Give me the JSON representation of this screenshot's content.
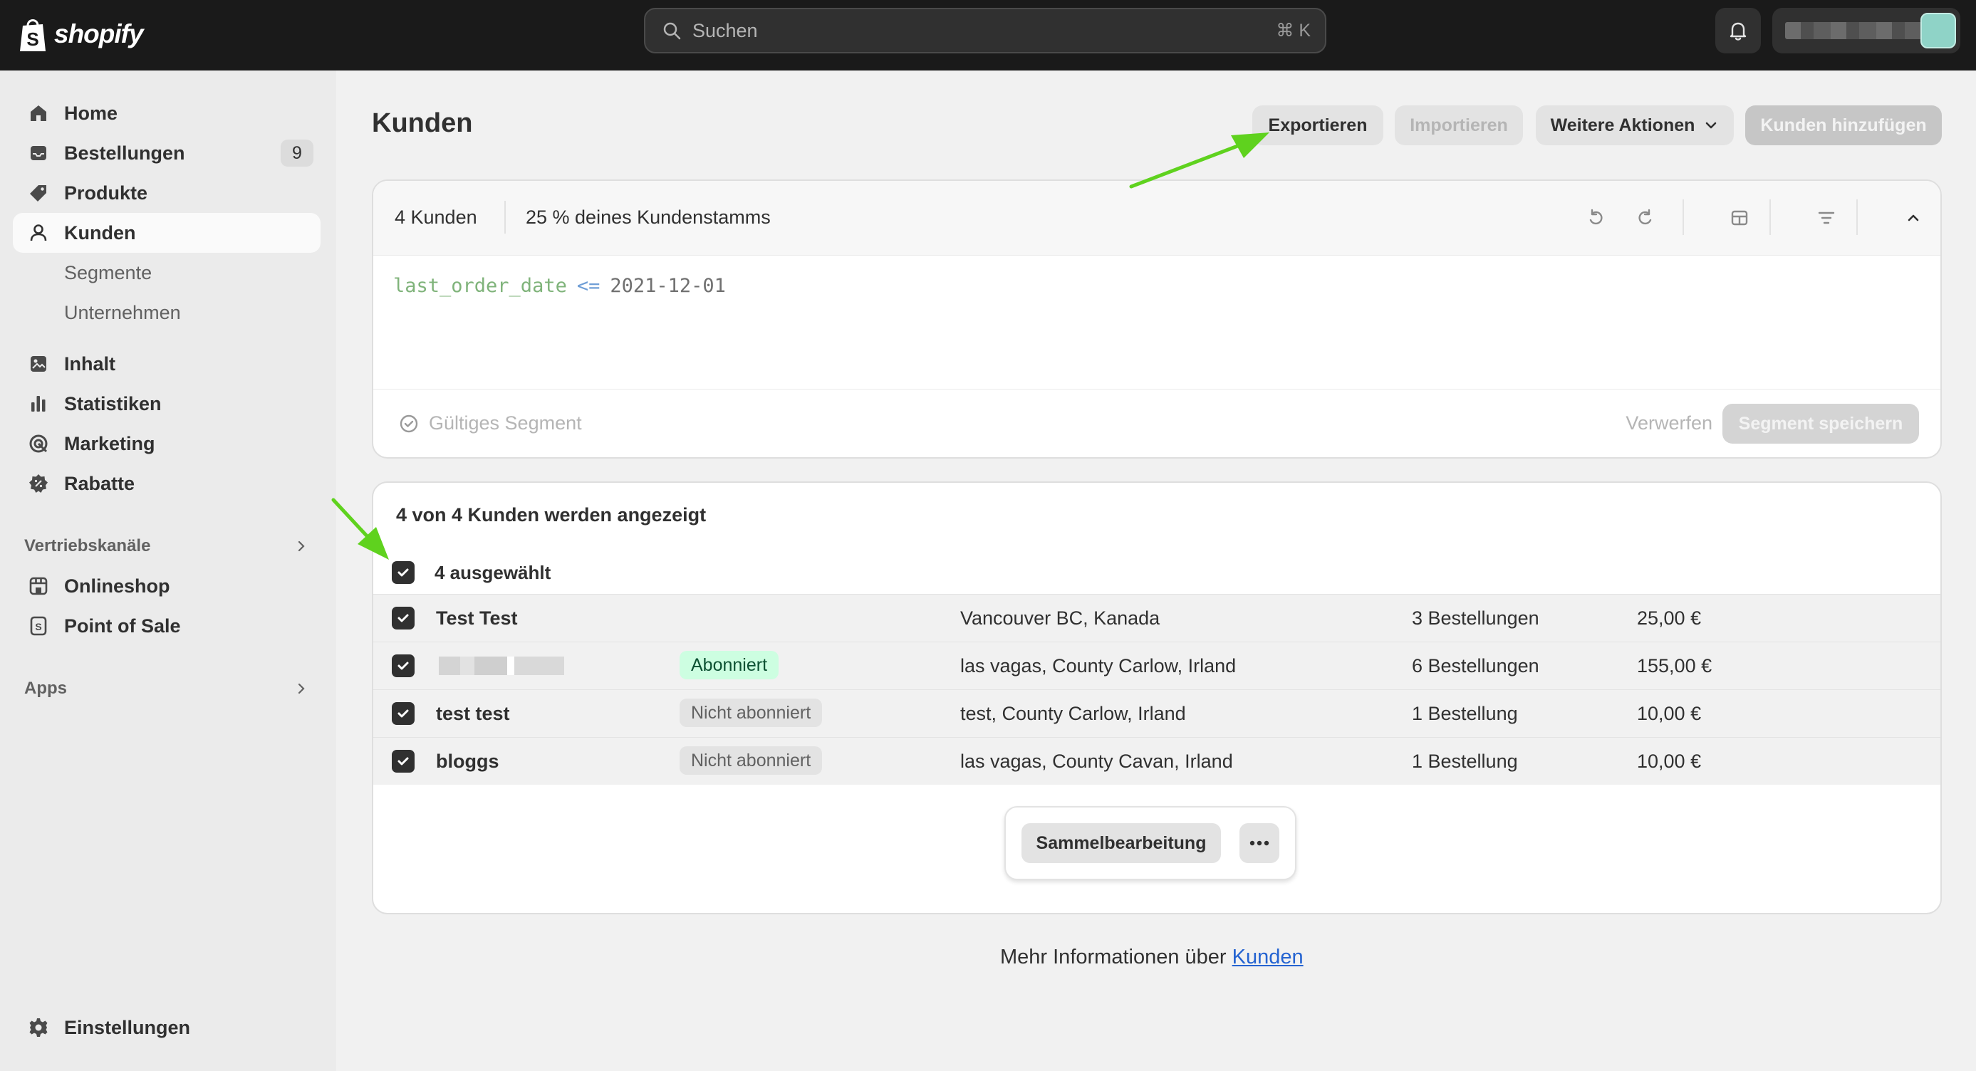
{
  "topbar": {
    "brand": "shopify",
    "search_placeholder": "Suchen",
    "search_shortcut": "⌘ K"
  },
  "sidebar": {
    "items": [
      {
        "label": "Home",
        "icon": "home-icon"
      },
      {
        "label": "Bestellungen",
        "icon": "inbox-icon",
        "badge": "9"
      },
      {
        "label": "Produkte",
        "icon": "tag-icon"
      },
      {
        "label": "Kunden",
        "icon": "person-icon",
        "active": true
      },
      {
        "label": "Segmente",
        "sub": true
      },
      {
        "label": "Unternehmen",
        "sub": true
      },
      {
        "label": "Inhalt",
        "icon": "content-icon"
      },
      {
        "label": "Statistiken",
        "icon": "bar-chart-icon"
      },
      {
        "label": "Marketing",
        "icon": "target-icon"
      },
      {
        "label": "Rabatte",
        "icon": "discount-icon"
      }
    ],
    "sales_channels_label": "Vertriebskanäle",
    "channels": [
      {
        "label": "Onlineshop",
        "icon": "store-icon"
      },
      {
        "label": "Point of Sale",
        "icon": "pos-icon"
      }
    ],
    "apps_label": "Apps",
    "settings_label": "Einstellungen"
  },
  "header": {
    "title": "Kunden",
    "export_label": "Exportieren",
    "import_label": "Importieren",
    "more_actions_label": "Weitere Aktionen",
    "add_customer_label": "Kunden hinzufügen"
  },
  "segment": {
    "count_label": "4 Kunden",
    "percent_label": "25 % deines Kundenstamms",
    "query_field": "last_order_date",
    "query_operator": "<=",
    "query_value": "2021-12-01",
    "valid_label": "Gültiges Segment",
    "discard_label": "Verwerfen",
    "save_label": "Segment speichern"
  },
  "list": {
    "title": "4 von 4 Kunden werden angezeigt",
    "selected_label": "4 ausgewählt",
    "rows": [
      {
        "name": "Test Test",
        "status": "",
        "location": "Vancouver BC, Kanada",
        "orders": "3 Bestellungen",
        "spent": "25,00 €"
      },
      {
        "name": "",
        "status": "Abonniert",
        "location": "las vagas, County Carlow, Irland",
        "orders": "6 Bestellungen",
        "spent": "155,00 €"
      },
      {
        "name": "test test",
        "status": "Nicht abonniert",
        "location": "test, County Carlow, Irland",
        "orders": "1 Bestellung",
        "spent": "10,00 €"
      },
      {
        "name": "bloggs",
        "status": "Nicht abonniert",
        "location": "las vagas, County Cavan, Irland",
        "orders": "1 Bestellung",
        "spent": "10,00 €"
      }
    ],
    "bulk_edit_label": "Sammelbearbeitung"
  },
  "footer": {
    "more_info_prefix": "Mehr Informationen über",
    "more_info_link": "Kunden"
  },
  "colors": {
    "topbar": "#1a1a1a",
    "annotation_arrow": "#5fd21e",
    "subscribed_badge": "#cdfee1"
  }
}
